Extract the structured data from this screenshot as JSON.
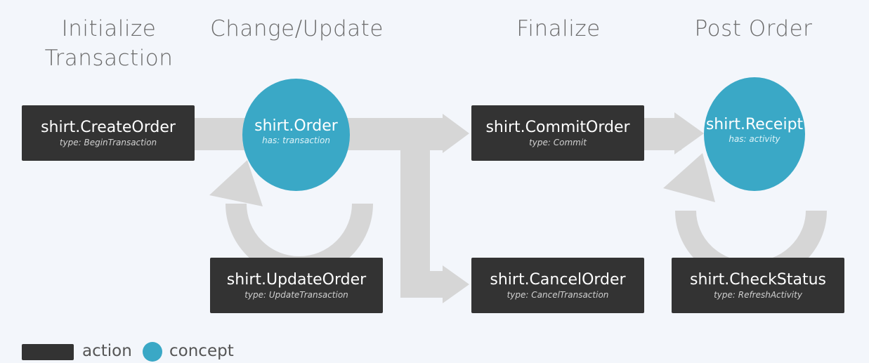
{
  "phases": {
    "initialize": "Initialize\nTransaction",
    "change_update": "Change/Update",
    "finalize": "Finalize",
    "post_order": "Post Order"
  },
  "actions": {
    "create_order": {
      "name": "shirt.CreateOrder",
      "type": "type: BeginTransaction"
    },
    "update_order": {
      "name": "shirt.UpdateOrder",
      "type": "type: UpdateTransaction"
    },
    "commit_order": {
      "name": "shirt.CommitOrder",
      "type": "type: Commit"
    },
    "cancel_order": {
      "name": "shirt.CancelOrder",
      "type": "type: CancelTransaction"
    },
    "check_status": {
      "name": "shirt.CheckStatus",
      "type": "type: RefreshActivity"
    }
  },
  "concepts": {
    "order": {
      "name": "shirt.Order",
      "has": "has: transaction"
    },
    "receipt": {
      "name": "shirt.Receipt",
      "has": "has: activity"
    }
  },
  "legend": {
    "action": "action",
    "concept": "concept"
  },
  "colors": {
    "background": "#f3f6fb",
    "action": "#333333",
    "concept": "#3aa8c6",
    "arrow": "#d6d6d6",
    "phase_text": "#6b6b6b"
  }
}
